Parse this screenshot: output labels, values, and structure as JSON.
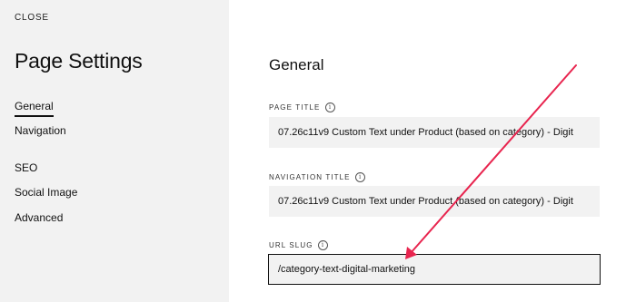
{
  "sidebar": {
    "close_label": "CLOSE",
    "title": "Page Settings",
    "items": [
      {
        "label": "General"
      },
      {
        "label": "Navigation"
      },
      {
        "label": "SEO"
      },
      {
        "label": "Social Image"
      },
      {
        "label": "Advanced"
      }
    ],
    "active_item": "General"
  },
  "main": {
    "section_title": "General",
    "fields": {
      "page_title": {
        "label": "PAGE TITLE",
        "value": "07.26c11v9 Custom Text under Product (based on category) - Digit"
      },
      "navigation_title": {
        "label": "NAVIGATION TITLE",
        "value": "07.26c11v9 Custom Text under Product (based on category) - Digit"
      },
      "url_slug": {
        "label": "URL SLUG",
        "value": "/category-text-digital-marketing"
      }
    }
  },
  "icons": {
    "info": "info-icon",
    "annotation": "arrow-annotation"
  },
  "colors": {
    "sidebar_bg": "#f2f2f2",
    "input_bg": "#f2f2f2",
    "arrow": "#e8254f",
    "text": "#111111"
  }
}
